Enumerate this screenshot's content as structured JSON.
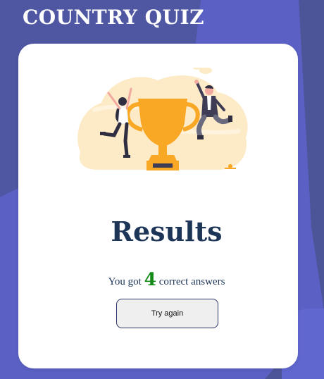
{
  "app": {
    "title": "COUNTRY QUIZ"
  },
  "results": {
    "heading": "Results",
    "score_prefix": "You got",
    "score_value": "4",
    "score_suffix": "correct answers",
    "try_again_label": "Try again"
  },
  "illustration": {
    "icon": "celebration-trophy-illustration"
  },
  "colors": {
    "background": "#5b61c4",
    "card": "#ffffff",
    "heading": "#1d3557",
    "score_value": "#138a18",
    "trophy": "#f9a826",
    "blob": "#fdebc8"
  }
}
